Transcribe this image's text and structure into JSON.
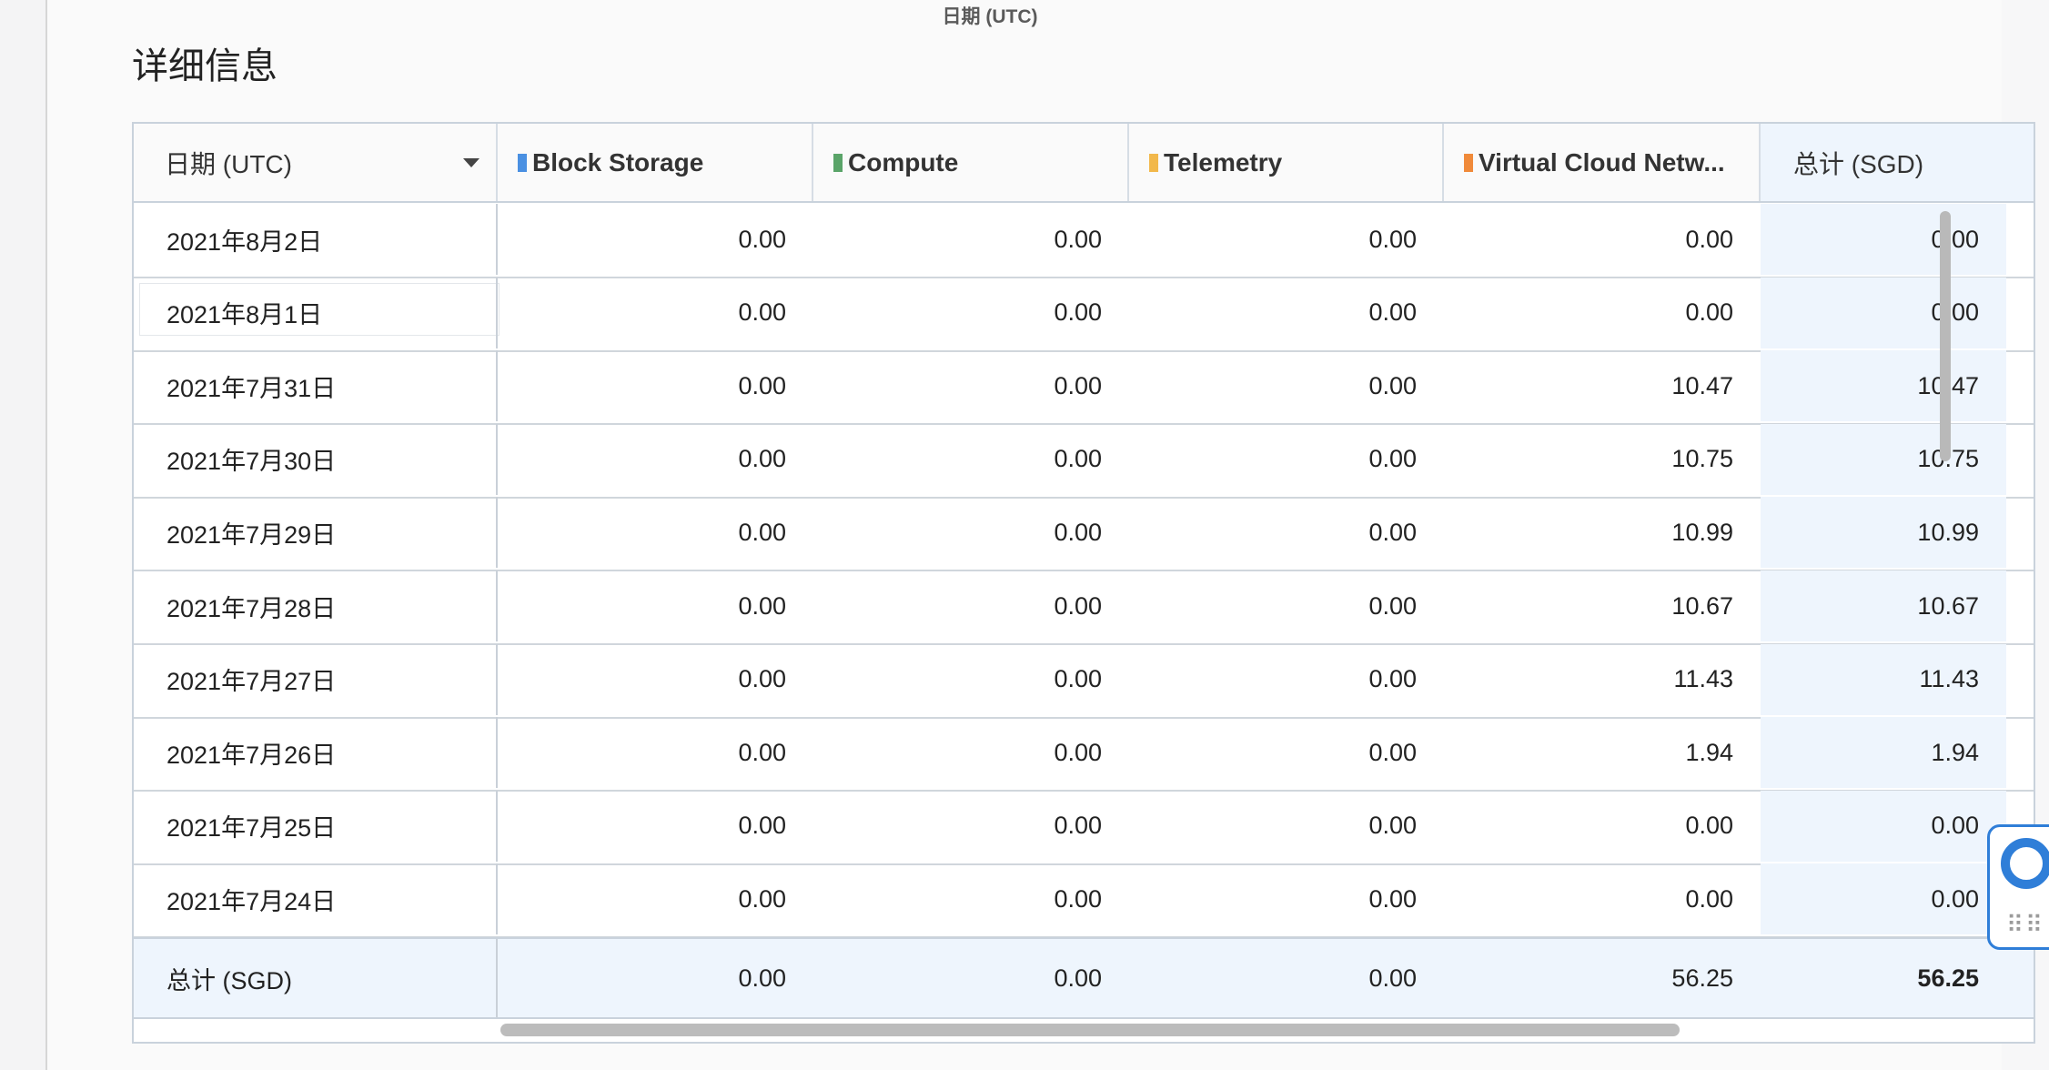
{
  "chart_axis_title": "日期 (UTC)",
  "section_title": "详细信息",
  "table": {
    "columns": [
      {
        "label": "日期 (UTC)",
        "color": ""
      },
      {
        "label": "Block Storage",
        "color": "#4a90e2"
      },
      {
        "label": "Compute",
        "color": "#5aa469"
      },
      {
        "label": "Telemetry",
        "color": "#f2b84b"
      },
      {
        "label": "Virtual Cloud Netw...",
        "color": "#f08a3a"
      },
      {
        "label": "总计 (SGD)",
        "color": ""
      }
    ],
    "rows": [
      [
        "2021年8月2日",
        "0.00",
        "0.00",
        "0.00",
        "0.00",
        "0.00"
      ],
      [
        "2021年8月1日",
        "0.00",
        "0.00",
        "0.00",
        "0.00",
        "0.00"
      ],
      [
        "2021年7月31日",
        "0.00",
        "0.00",
        "0.00",
        "10.47",
        "10.47"
      ],
      [
        "2021年7月30日",
        "0.00",
        "0.00",
        "0.00",
        "10.75",
        "10.75"
      ],
      [
        "2021年7月29日",
        "0.00",
        "0.00",
        "0.00",
        "10.99",
        "10.99"
      ],
      [
        "2021年7月28日",
        "0.00",
        "0.00",
        "0.00",
        "10.67",
        "10.67"
      ],
      [
        "2021年7月27日",
        "0.00",
        "0.00",
        "0.00",
        "11.43",
        "11.43"
      ],
      [
        "2021年7月26日",
        "0.00",
        "0.00",
        "0.00",
        "1.94",
        "1.94"
      ],
      [
        "2021年7月25日",
        "0.00",
        "0.00",
        "0.00",
        "0.00",
        "0.00"
      ],
      [
        "2021年7月24日",
        "0.00",
        "0.00",
        "0.00",
        "0.00",
        "0.00"
      ]
    ],
    "footer": [
      "总计 (SGD)",
      "0.00",
      "0.00",
      "0.00",
      "56.25",
      "56.25"
    ]
  },
  "icons": {
    "sort": "caret-down-icon",
    "help": "lifebuoy-icon",
    "apps": "grid-icon"
  }
}
